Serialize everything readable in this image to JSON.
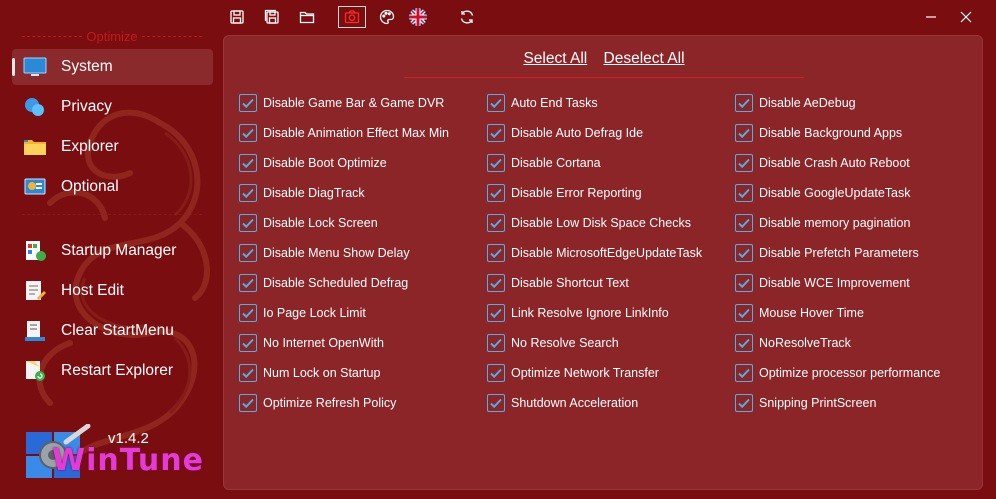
{
  "titlebar": {
    "icons": [
      "save-icon",
      "save-all-icon",
      "open-folder-icon",
      "camera-icon",
      "palette-icon",
      "uk-flag-icon",
      "refresh-icon"
    ],
    "window_buttons": [
      "minimize-icon",
      "close-icon"
    ]
  },
  "sidebar": {
    "section_label": "Optimize",
    "items": [
      {
        "label": "System",
        "icon": "monitor-icon",
        "selected": true
      },
      {
        "label": "Privacy",
        "icon": "privacy-icon"
      },
      {
        "label": "Explorer",
        "icon": "folder-icon"
      },
      {
        "label": "Optional",
        "icon": "optional-icon"
      },
      {
        "label": "Startup Manager",
        "icon": "startup-icon"
      },
      {
        "label": "Host Edit",
        "icon": "host-edit-icon"
      },
      {
        "label": "Clear StartMenu",
        "icon": "startmenu-icon"
      },
      {
        "label": "Restart Explorer",
        "icon": "restart-explorer-icon"
      }
    ],
    "version": "v1.4.2",
    "logo_text": "WinTune"
  },
  "actions": {
    "select_all": "Select All",
    "deselect_all": "Deselect All"
  },
  "options": {
    "col1": [
      "Disable Game Bar & Game DVR",
      "Disable Animation Effect Max Min",
      "Disable Boot Optimize",
      "Disable DiagTrack",
      "Disable Lock Screen",
      "Disable Menu Show Delay",
      "Disable Scheduled Defrag",
      "Io Page Lock Limit",
      "No Internet OpenWith",
      "Num Lock on Startup",
      "Optimize Refresh Policy"
    ],
    "col2": [
      "Auto End Tasks",
      "Disable Auto Defrag Ide",
      "Disable Cortana",
      "Disable Error Reporting",
      "Disable Low Disk Space Checks",
      "Disable MicrosoftEdgeUpdateTask",
      "Disable Shortcut Text",
      "Link Resolve Ignore LinkInfo",
      "No Resolve Search",
      "Optimize Network Transfer",
      "Shutdown Acceleration"
    ],
    "col3": [
      "Disable AeDebug",
      "Disable Background Apps",
      "Disable Crash Auto Reboot",
      "Disable GoogleUpdateTask",
      "Disable memory pagination",
      "Disable Prefetch Parameters",
      "Disable WCE Improvement",
      "Mouse Hover Time",
      "NoResolveTrack",
      "Optimize processor performance",
      "Snipping PrintScreen"
    ],
    "checked": true
  },
  "colors": {
    "background": "#7a0d10",
    "panel": "#8b2527",
    "checkbox_accent": "#4db0e8",
    "section_label": "#c11a1a"
  }
}
